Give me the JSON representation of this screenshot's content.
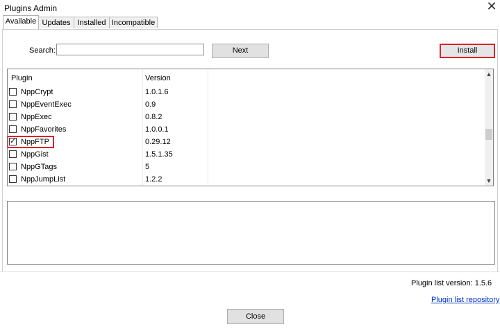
{
  "window": {
    "title": "Plugins Admin",
    "close_glyph": "✕"
  },
  "tabs": [
    {
      "label": "Available",
      "active": true
    },
    {
      "label": "Updates",
      "active": false
    },
    {
      "label": "Installed",
      "active": false
    },
    {
      "label": "Incompatible",
      "active": false
    }
  ],
  "search": {
    "label": "Search:",
    "value": "",
    "placeholder": ""
  },
  "buttons": {
    "next": "Next",
    "install": "Install",
    "close": "Close"
  },
  "table": {
    "headers": {
      "plugin": "Plugin",
      "version": "Version"
    },
    "rows": [
      {
        "name": "NppCrypt",
        "version": "1.0.1.6",
        "checked": false
      },
      {
        "name": "NppEventExec",
        "version": "0.9",
        "checked": false
      },
      {
        "name": "NppExec",
        "version": "0.8.2",
        "checked": false
      },
      {
        "name": "NppFavorites",
        "version": "1.0.0.1",
        "checked": false
      },
      {
        "name": "NppFTP",
        "version": "0.29.12",
        "checked": true
      },
      {
        "name": "NppGist",
        "version": "1.5.1.35",
        "checked": false
      },
      {
        "name": "NppGTags",
        "version": "5",
        "checked": false
      },
      {
        "name": "NppJumpList",
        "version": "1.2.2",
        "checked": false
      }
    ]
  },
  "footer": {
    "plugin_list_version": "Plugin list version:  1.5.6",
    "repo_link": "Plugin list repository"
  },
  "colors": {
    "highlight": "#d9232a",
    "link": "#0033cc"
  }
}
